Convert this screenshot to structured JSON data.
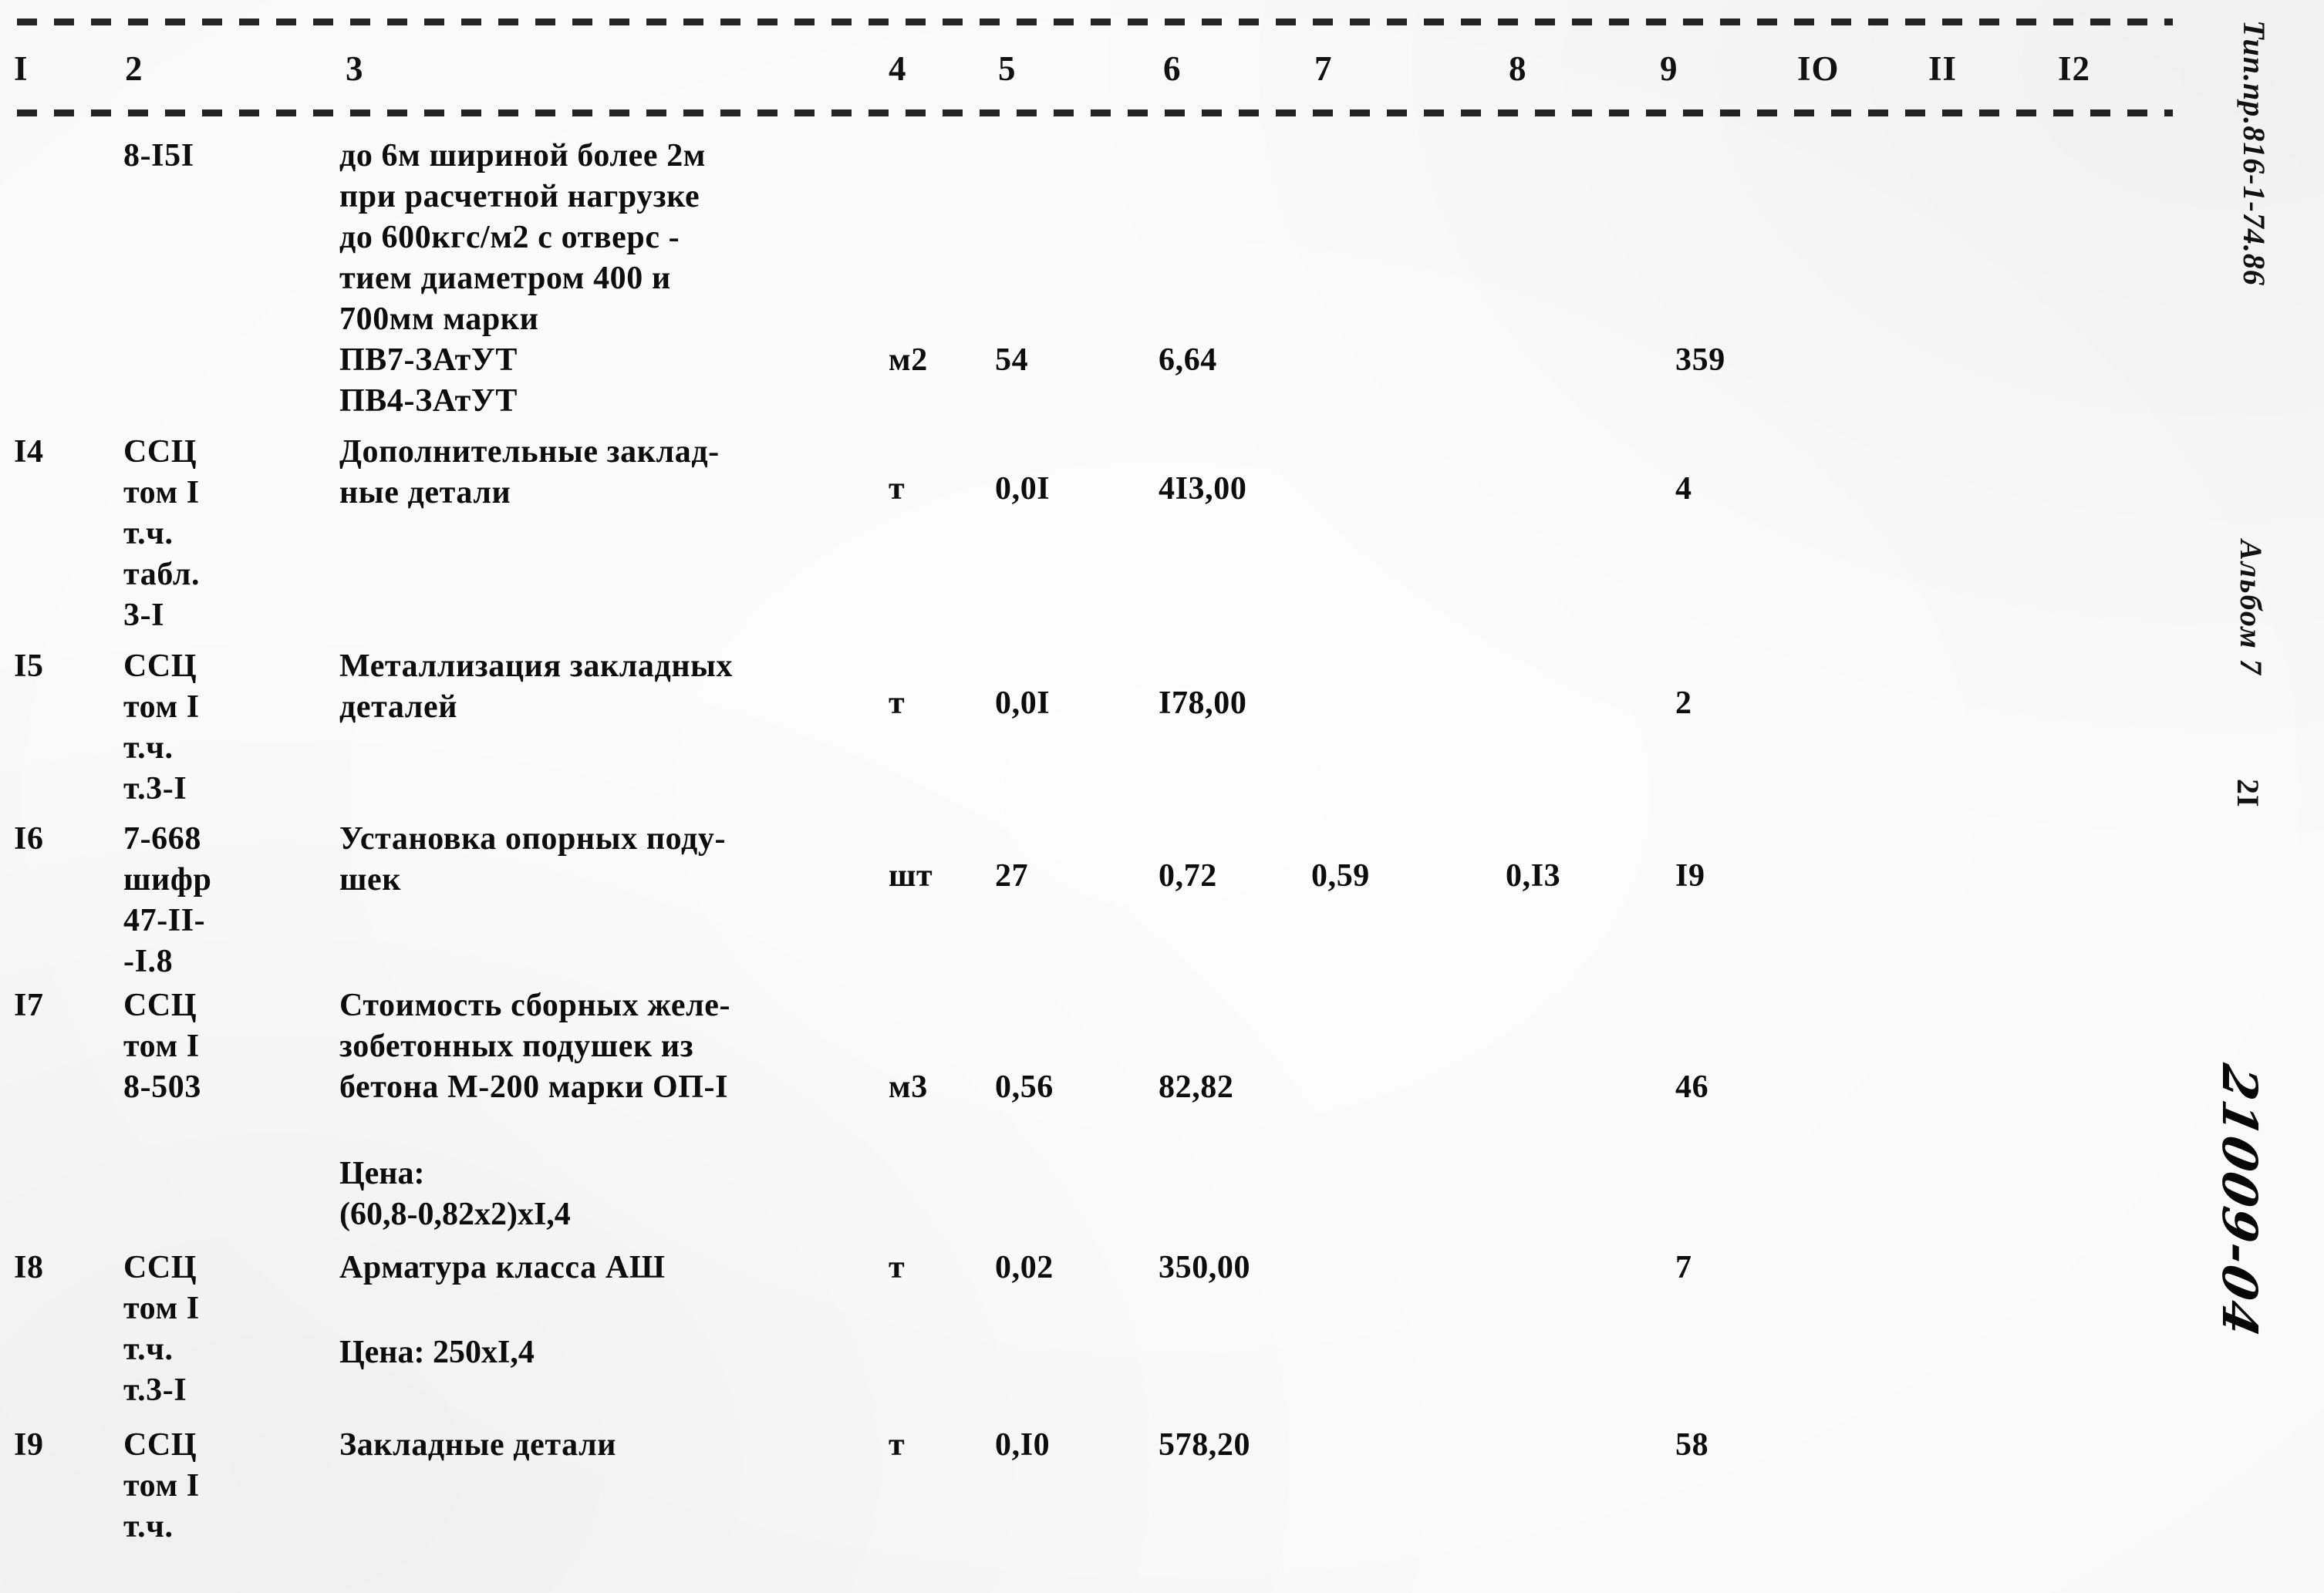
{
  "document": {
    "type": "construction-estimate-table",
    "language": "ru"
  },
  "table": {
    "column_headers": [
      "I",
      "2",
      "3",
      "4",
      "5",
      "6",
      "7",
      "8",
      "9",
      "IO",
      "II",
      "I2"
    ],
    "rows": [
      {
        "num": "",
        "code": "8-I5I",
        "description": "до 6м шириной более 2м\nпри  расчетной нагрузке\nдо 600кгс/м2 с отверс -\nтием диаметром 400 и\n700мм марки\nПВ7-ЗАтУТ\nПВ4-ЗАтУТ",
        "unit": "м2",
        "qty": "54",
        "col6": "6,64",
        "col7": "",
        "col8": "",
        "col9": "359",
        "note": ""
      },
      {
        "num": "I4",
        "code": "ССЦ\nтом I\nт.ч.\nтабл.\n3-I",
        "description": "Дополнительные заклад-\nные детали",
        "unit": "т",
        "qty": "0,0I",
        "col6": "4I3,00",
        "col7": "",
        "col8": "",
        "col9": "4",
        "note": ""
      },
      {
        "num": "I5",
        "code": "ССЦ\nтом I\nт.ч.\nт.3-I",
        "description": "Металлизация закладных\nдеталей",
        "unit": "т",
        "qty": "0,0I",
        "col6": "I78,00",
        "col7": "",
        "col8": "",
        "col9": "2",
        "note": ""
      },
      {
        "num": "I6",
        "code": "7-668\nшифр\n47-II-\n-I.8",
        "description": "Установка опорных поду-\nшек",
        "unit": "шт",
        "qty": "27",
        "col6": "0,72",
        "col7": "0,59",
        "col8": "0,I3",
        "col9": "I9",
        "note": ""
      },
      {
        "num": "I7",
        "code": "ССЦ\nтом I\n8-503",
        "description": "Стоимость сборных желе-\nзобетонных подушек из\nбетона М-200 марки ОП-I",
        "unit": "м3",
        "qty": "0,56",
        "col6": "82,82",
        "col7": "",
        "col8": "",
        "col9": "46",
        "note": "Цена:\n(60,8-0,82х2)хI,4"
      },
      {
        "num": "I8",
        "code": "ССЦ\nтом I\nт.ч.\nт.3-I",
        "description": "Арматура класса АШ",
        "unit": "т",
        "qty": "0,02",
        "col6": "350,00",
        "col7": "",
        "col8": "",
        "col9": "7",
        "note": "Цена: 250хI,4"
      },
      {
        "num": "I9",
        "code": "ССЦ\nтом I\nт.ч.",
        "description": "Закладные детали",
        "unit": "т",
        "qty": "0,I0",
        "col6": "578,20",
        "col7": "",
        "col8": "",
        "col9": "58",
        "note": ""
      }
    ]
  },
  "margin": {
    "document_ref": "Тип.пр.816-1-74.86",
    "album": "Альбом 7",
    "page": "2I",
    "stamp": "21009-04"
  }
}
